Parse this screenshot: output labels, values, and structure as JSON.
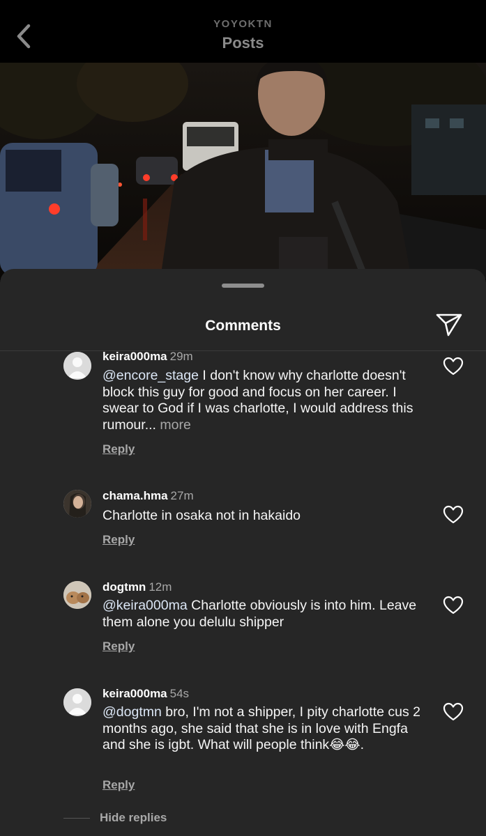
{
  "header": {
    "username": "YOYOKTN",
    "title": "Posts",
    "back_icon": "chevron-left-icon"
  },
  "comments_sheet": {
    "title": "Comments",
    "share_icon": "paper-plane-icon"
  },
  "comments": [
    {
      "username": "keira000ma",
      "time": "29m",
      "mention": "@encore_stage",
      "text": " I don't know why charlotte doesn't block this guy for good and focus on her career. I swear to God if I was charlotte, I would address this rumour...",
      "more": " more",
      "reply_label": "Reply"
    },
    {
      "username": "chama.hma",
      "time": "27m",
      "mention": "",
      "text": "Charlotte in osaka not in hakaido",
      "reply_label": "Reply"
    },
    {
      "username": "dogtmn",
      "time": "12m",
      "mention": "@keira000ma",
      "text": " Charlotte obviously is into him. Leave them alone you delulu shipper",
      "reply_label": "Reply"
    },
    {
      "username": "keira000ma",
      "time": "54s",
      "mention": "@dogtmn",
      "text": " bro, I'm not a shipper, I pity charlotte cus 2 months ago, she said that she is in love with Engfa and she is igbt. What will people think",
      "emoji": "😂😂",
      "suffix": ".",
      "reply_label": "Reply"
    }
  ],
  "hide_replies_label": "Hide replies",
  "colors": {
    "sheet_bg": "#262626",
    "mention": "#dbe6f5",
    "muted": "#a8a8a8"
  }
}
